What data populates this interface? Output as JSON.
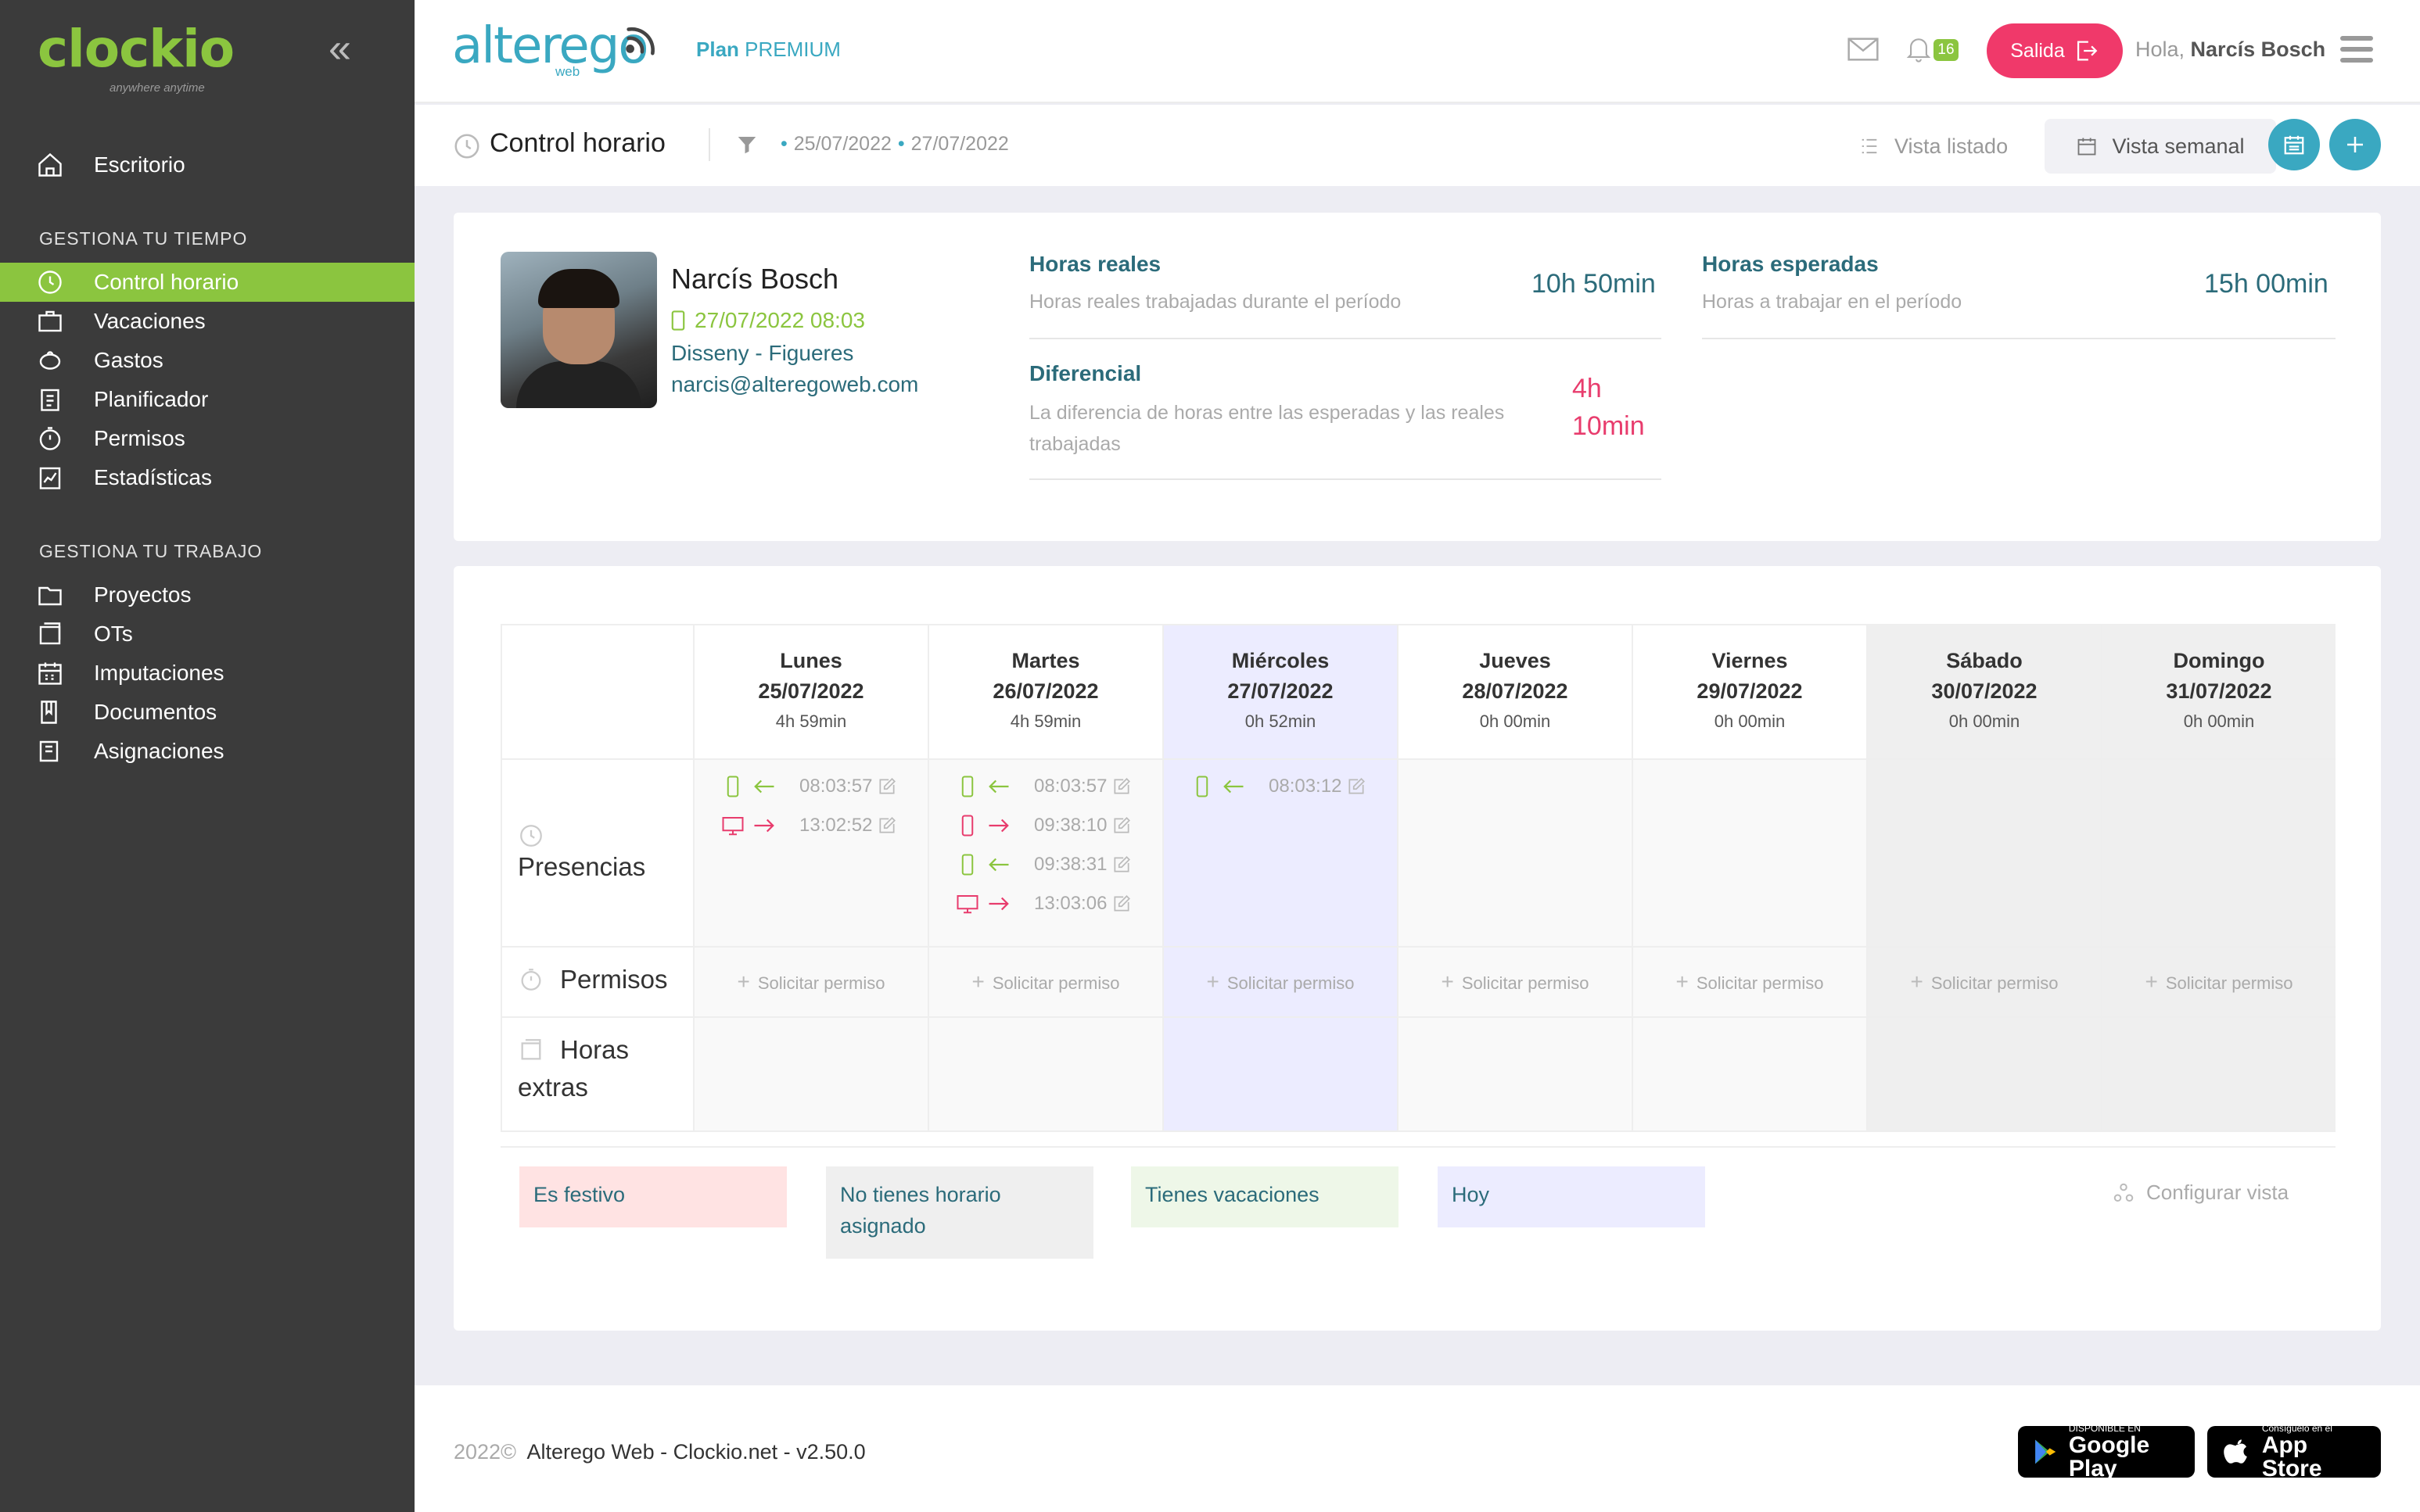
{
  "sidebar": {
    "logo": "clockio",
    "tagline": "anywhere anytime",
    "escritorio": "Escritorio",
    "section1": "GESTIONA TU TIEMPO",
    "section2": "GESTIONA TU TRABAJO",
    "items_tiempo": [
      "Control horario",
      "Vacaciones",
      "Gastos",
      "Planificador",
      "Permisos",
      "Estadísticas"
    ],
    "items_trabajo": [
      "Proyectos",
      "OTs",
      "Imputaciones",
      "Documentos",
      "Asignaciones"
    ],
    "active_item": "Control horario",
    "accent": "#8bc53f",
    "bg": "#3b3b3b"
  },
  "topbar": {
    "brand": "alterego",
    "brand_sub": "web",
    "plan_label": "Plan",
    "plan_name": "PREMIUM",
    "notifications": "16",
    "salida_label": "Salida",
    "greeting": "Hola,",
    "user_name": "Narcís Bosch",
    "brand_color": "#3aa8c1",
    "salida_color": "#f0396a"
  },
  "subheader": {
    "title": "Control horario",
    "date_from": "25/07/2022",
    "date_to": "27/07/2022",
    "vista_listado": "Vista listado",
    "vista_semanal": "Vista semanal"
  },
  "profile": {
    "name": "Narcís Bosch",
    "last_punch": "27/07/2022 08:03",
    "department": "Disseny - Figueres",
    "email": "narcis@alteregoweb.com",
    "horas_reales_title": "Horas reales",
    "horas_reales_desc": "Horas reales trabajadas durante el período",
    "horas_reales_value": "10h 50min",
    "horas_esperadas_title": "Horas esperadas",
    "horas_esperadas_desc": "Horas a trabajar en el período",
    "horas_esperadas_value": "15h 00min",
    "diferencial_title": "Diferencial",
    "diferencial_desc": "La diferencia de horas entre las esperadas y las reales trabajadas",
    "diferencial_value_1": "4h",
    "diferencial_value_2": "10min"
  },
  "calendar": {
    "rows": {
      "presencias": "Presencias",
      "permisos": "Permisos",
      "horas_extras_1": "Horas",
      "horas_extras_2": "extras"
    },
    "solicitar": "Solicitar permiso",
    "days": [
      {
        "name": "Lunes",
        "date": "25/07/2022",
        "hours": "4h 59min",
        "kind": "normal",
        "punches": [
          {
            "device": "mobile",
            "dir": "in",
            "time": "08:03:57"
          },
          {
            "device": "desktop",
            "dir": "out",
            "time": "13:02:52"
          }
        ]
      },
      {
        "name": "Martes",
        "date": "26/07/2022",
        "hours": "4h 59min",
        "kind": "normal",
        "punches": [
          {
            "device": "mobile",
            "dir": "in",
            "time": "08:03:57"
          },
          {
            "device": "mobile-red",
            "dir": "out",
            "time": "09:38:10"
          },
          {
            "device": "mobile",
            "dir": "in",
            "time": "09:38:31"
          },
          {
            "device": "desktop",
            "dir": "out",
            "time": "13:03:06"
          }
        ]
      },
      {
        "name": "Miércoles",
        "date": "27/07/2022",
        "hours": "0h 52min",
        "kind": "today",
        "punches": [
          {
            "device": "mobile",
            "dir": "in",
            "time": "08:03:12"
          }
        ]
      },
      {
        "name": "Jueves",
        "date": "28/07/2022",
        "hours": "0h 00min",
        "kind": "normal",
        "punches": []
      },
      {
        "name": "Viernes",
        "date": "29/07/2022",
        "hours": "0h 00min",
        "kind": "normal",
        "punches": []
      },
      {
        "name": "Sábado",
        "date": "30/07/2022",
        "hours": "0h 00min",
        "kind": "noschedule",
        "punches": []
      },
      {
        "name": "Domingo",
        "date": "31/07/2022",
        "hours": "0h 00min",
        "kind": "noschedule",
        "punches": []
      }
    ]
  },
  "legend": {
    "festivo": "Es festivo",
    "no_horario_1": "No tienes horario",
    "no_horario_2": "asignado",
    "vacaciones": "Tienes vacaciones",
    "hoy": "Hoy",
    "configurar": "Configurar vista",
    "colors": {
      "festivo": "#ffe3e3",
      "no_horario": "#efefef",
      "vacaciones": "#eef7e8",
      "hoy": "#ececff"
    }
  },
  "footer": {
    "year": "2022©",
    "text": "Alterego Web - Clockio.net - v2.50.0",
    "gplay_small": "DISPONIBLE EN",
    "gplay_big": "Google Play",
    "appstore_small": "Consíguelo en el",
    "appstore_big": "App Store"
  }
}
